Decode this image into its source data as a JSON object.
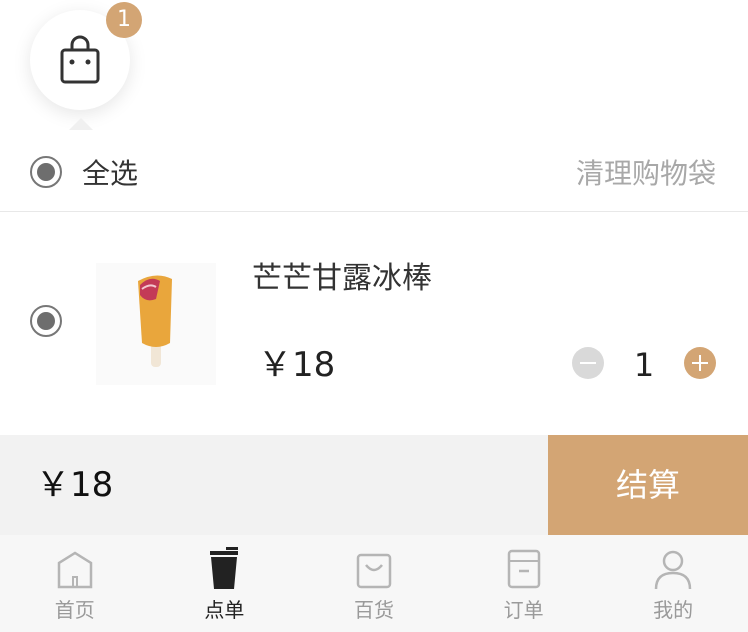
{
  "cart": {
    "count": "1"
  },
  "select_all": {
    "label": "全选",
    "clear_label": "清理购物袋"
  },
  "item": {
    "name": "芒芒甘露冰棒",
    "price": "￥18",
    "quantity": "1"
  },
  "summary": {
    "total": "￥18",
    "checkout_label": "结算"
  },
  "tabs": [
    {
      "label": "首页",
      "icon": "home-icon",
      "active": false
    },
    {
      "label": "点单",
      "icon": "drink-cup-icon",
      "active": true
    },
    {
      "label": "百货",
      "icon": "shopping-bag-icon",
      "active": false
    },
    {
      "label": "订单",
      "icon": "order-icon",
      "active": false
    },
    {
      "label": "我的",
      "icon": "user-icon",
      "active": false
    }
  ],
  "colors": {
    "accent": "#d3a574",
    "background": "#ffffff",
    "bar": "#f2f2f2"
  }
}
